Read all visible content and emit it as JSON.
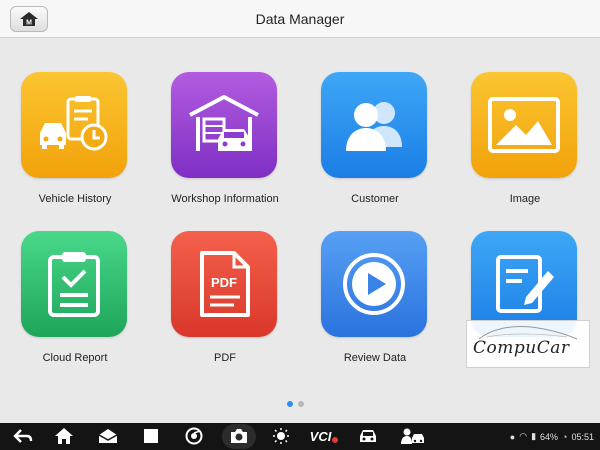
{
  "header": {
    "title": "Data Manager",
    "home_icon": "home-m-icon",
    "home_letter": "M"
  },
  "tiles": [
    {
      "label": "Vehicle History",
      "icon": "vehicle-history-icon",
      "color": "#f7b51c"
    },
    {
      "label": "Workshop Information",
      "icon": "workshop-garage-icon",
      "color": "#9a44d6"
    },
    {
      "label": "Customer",
      "icon": "customer-users-icon",
      "color": "#2a93ee"
    },
    {
      "label": "Image",
      "icon": "image-icon",
      "color": "#f7b51c"
    },
    {
      "label": "Cloud Report",
      "icon": "cloud-report-clipboard-icon",
      "color": "#30c06f"
    },
    {
      "label": "PDF",
      "icon": "pdf-file-icon",
      "color": "#e84a3a"
    },
    {
      "label": "Review Data",
      "icon": "play-icon",
      "color": "#3d88ea"
    },
    {
      "label": "",
      "icon": "edit-document-icon",
      "color": "#2a93ee"
    }
  ],
  "pagination": {
    "pages": 2,
    "current": 1
  },
  "watermark": {
    "text": "CompuCar"
  },
  "navbar": {
    "icons": [
      "back-icon",
      "home-icon",
      "mail-icon",
      "square-icon",
      "chrome-icon",
      "camera-icon",
      "brightness-icon",
      "vci-icon",
      "car-icon",
      "user-car-icon"
    ],
    "vci_label": "VCI"
  },
  "status": {
    "battery": "64%",
    "time": "05:51"
  }
}
